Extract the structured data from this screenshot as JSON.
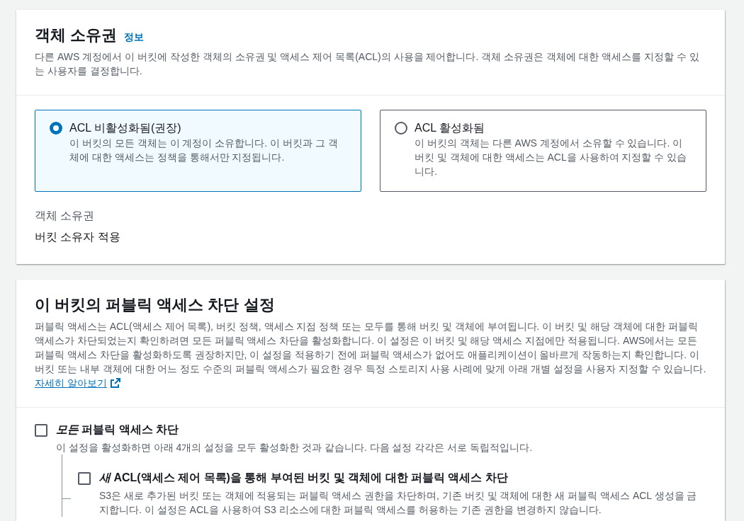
{
  "ownership": {
    "title": "객체 소유권",
    "info_link": "정보",
    "description": "다른 AWS 계정에서 이 버킷에 작성한 객체의 소유권 및 액세스 제어 목록(ACL)의 사용을 제어합니다. 객체 소유권은 객체에 대한 액세스를 지정할 수 있는 사용자를 결정합니다.",
    "options": [
      {
        "title": "ACL 비활성화됨(권장)",
        "description": "이 버킷의 모든 객체는 이 계정이 소유합니다. 이 버킷과 그 객체에 대한 액세스는 정책을 통해서만 지정됩니다.",
        "selected": true
      },
      {
        "title": "ACL 활성화됨",
        "description": "이 버킷의 객체는 다른 AWS 계정에서 소유할 수 있습니다. 이 버킷 및 객체에 대한 액세스는 ACL을 사용하여 지정할 수 있습니다.",
        "selected": false
      }
    ],
    "summary_label": "객체 소유권",
    "summary_value": "버킷 소유자 적용"
  },
  "block_public_access": {
    "title": "이 버킷의 퍼블릭 액세스 차단 설정",
    "description": "퍼블릭 액세스는 ACL(액세스 제어 목록), 버킷 정책, 액세스 지점 정책 또는 모두를 통해 버킷 및 객체에 부여됩니다. 이 버킷 및 해당 객체에 대한 퍼블릭 액세스가 차단되었는지 확인하려면 모든 퍼블릭 액세스 차단을 활성화합니다. 이 설정은 이 버킷 및 해당 액세스 지점에만 적용됩니다. AWS에서는 모든 퍼블릭 액세스 차단을 활성화하도록 권장하지만, 이 설정을 적용하기 전에 퍼블릭 액세스가 없어도 애플리케이션이 올바르게 작동하는지 확인합니다. 이 버킷 또는 내부 객체에 대한 어느 정도 수준의 퍼블릭 액세스가 필요한 경우 특정 스토리지 사용 사례에 맞게 아래 개별 설정을 사용자 지정할 수 있습니다.",
    "learn_more": "자세히 알아보기",
    "settings": [
      {
        "label": "*모든* 퍼블릭 액세스 차단",
        "description": "이 설정을 활성화하면 아래 4개의 설정을 모두 활성화한 것과 같습니다. 다음 설정 각각은 서로 독립적입니다.",
        "checked": false,
        "children": [
          {
            "label": "*새* ACL(액세스 제어 목록)을 통해 부여된 버킷 및 객체에 대한 퍼블릭 액세스 차단",
            "description": "S3은 새로 추가된 버킷 또는 객체에 적용되는 퍼블릭 액세스 권한을 차단하며, 기존 버킷 및 객체에 대한 새 퍼블릭 액세스 ACL 생성을 금지합니다. 이 설정은 ACL을 사용하여 S3 리소스에 대한 퍼블릭 액세스를 허용하는 기존 권한을 변경하지 않습니다.",
            "checked": false
          }
        ]
      }
    ]
  }
}
